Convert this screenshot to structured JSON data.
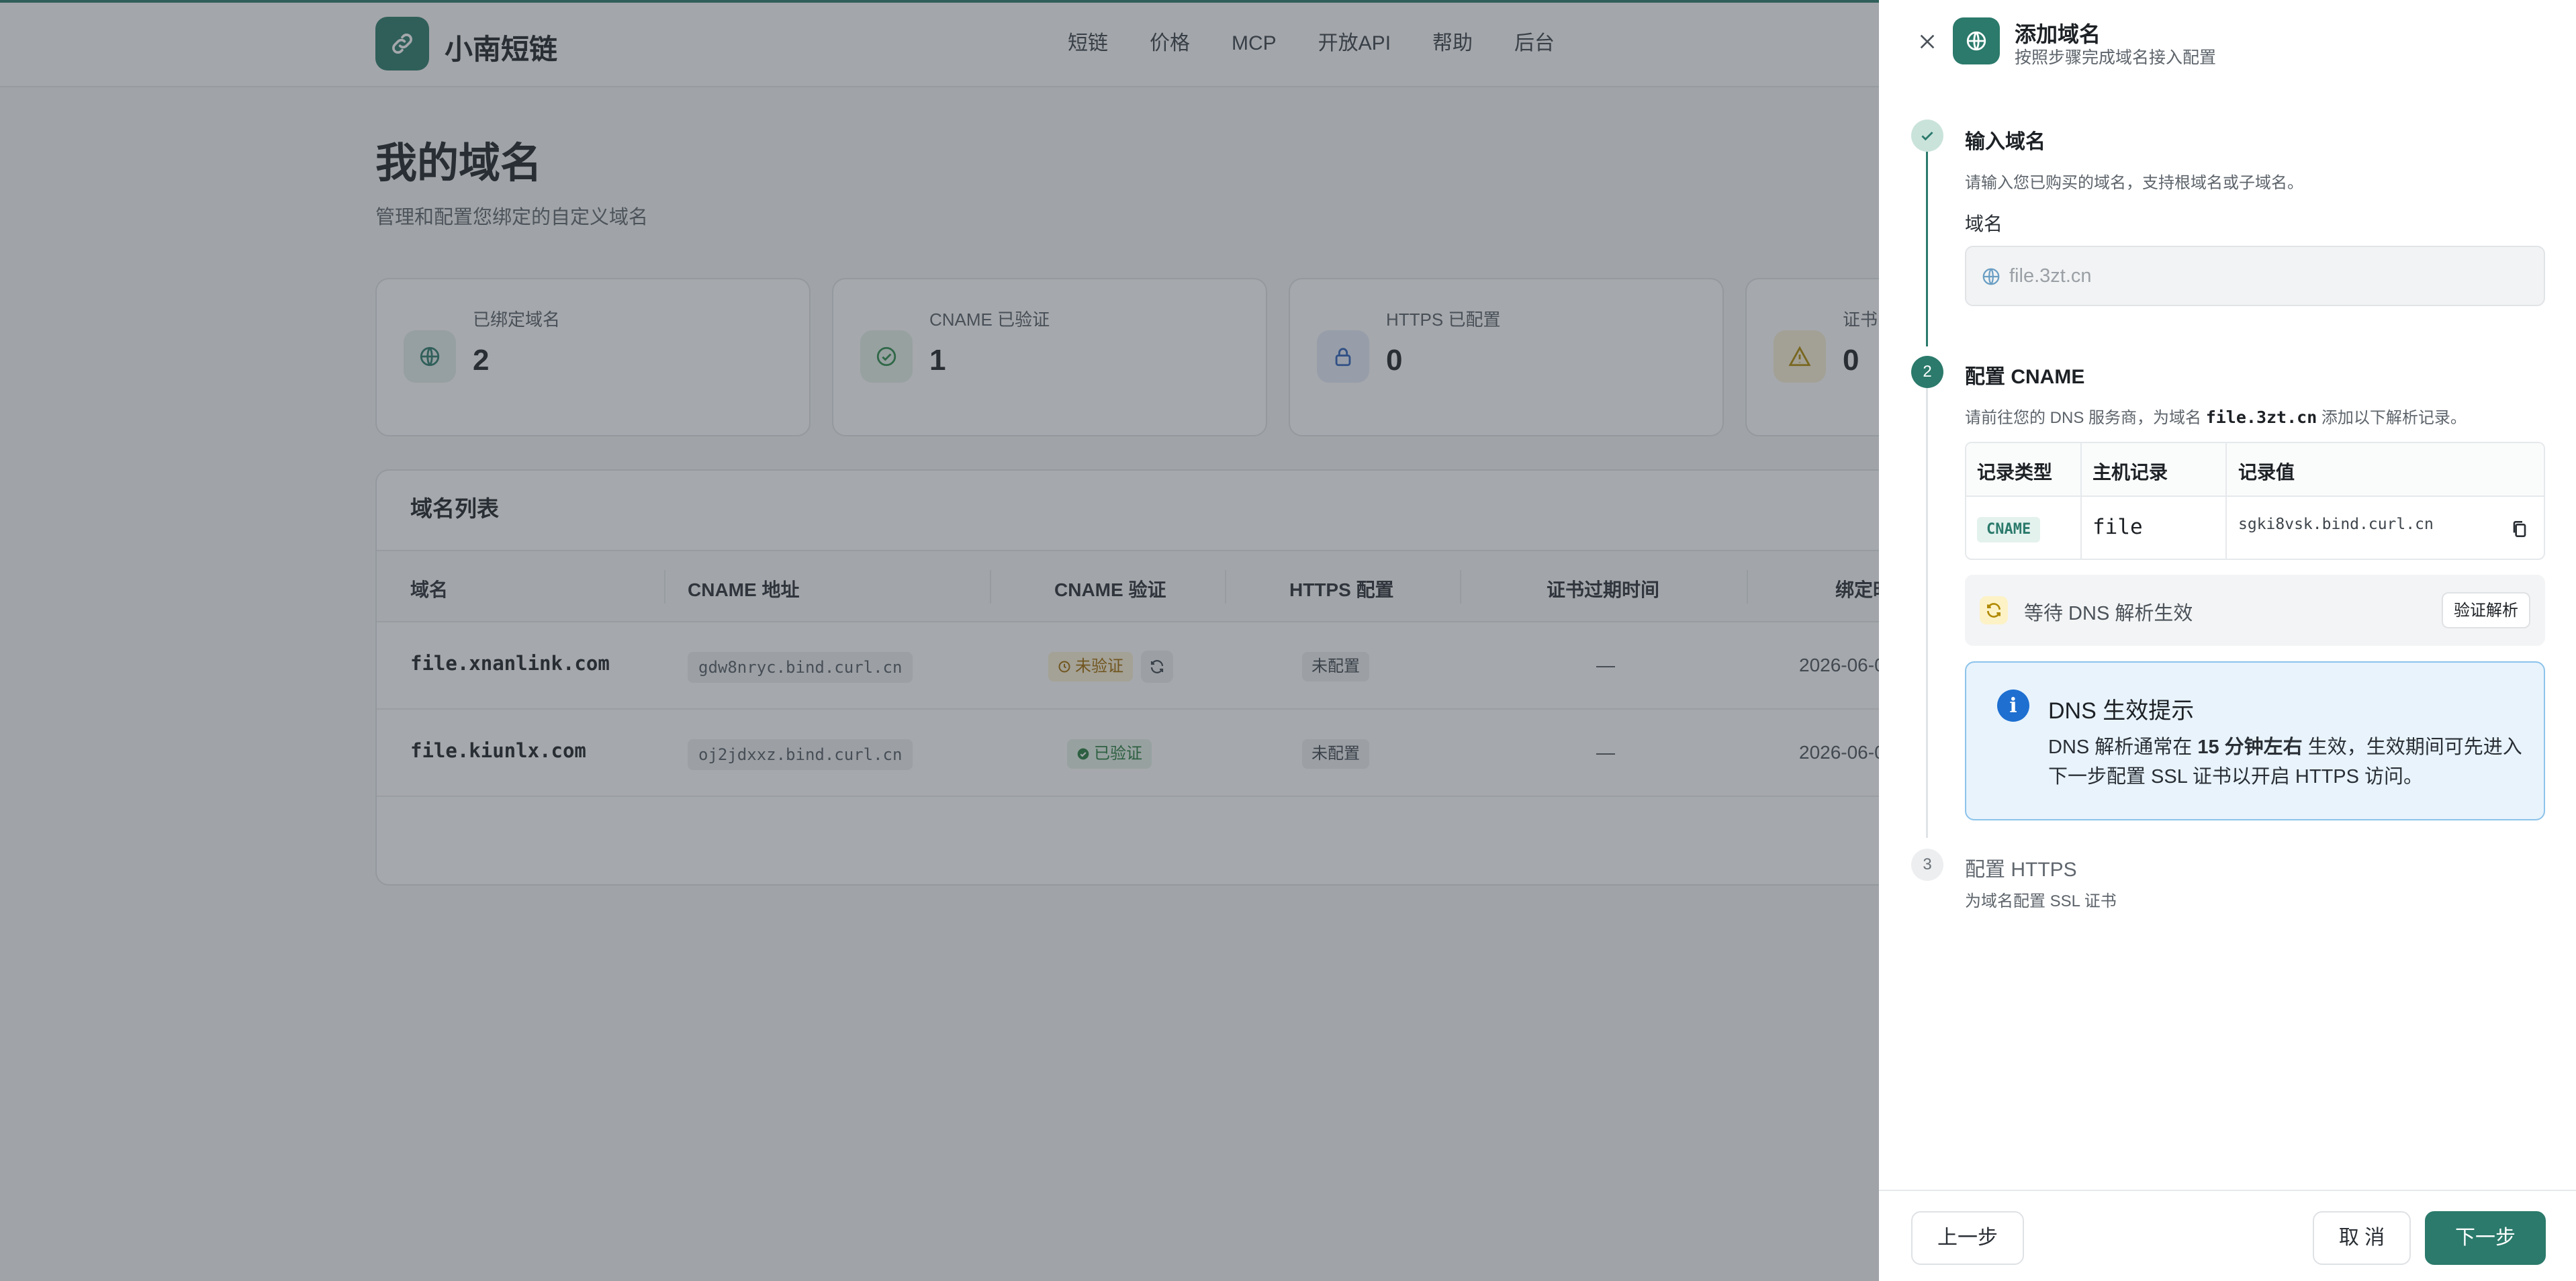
{
  "app": {
    "brand": "小南短链"
  },
  "nav": [
    "短链",
    "价格",
    "MCP",
    "开放API",
    "帮助",
    "后台"
  ],
  "page": {
    "title": "我的域名",
    "subtitle": "管理和配置您绑定的自定义域名"
  },
  "stats": [
    {
      "label": "已绑定域名",
      "value": "2",
      "icon": "globe-icon",
      "color": "#2b7a6b"
    },
    {
      "label": "CNAME 已验证",
      "value": "1",
      "icon": "check-circle-icon",
      "color": "#2b8a4a"
    },
    {
      "label": "HTTPS 已配置",
      "value": "0",
      "icon": "lock-icon",
      "color": "#2c5fb8"
    },
    {
      "label": "证书即将过期",
      "value": "0",
      "icon": "warning-icon",
      "color": "#b08900"
    }
  ],
  "list": {
    "title": "域名列表",
    "columns": [
      "域名",
      "CNAME 地址",
      "CNAME 验证",
      "HTTPS 配置",
      "证书过期时间",
      "绑定时间"
    ],
    "rows": [
      {
        "domain": "file.xnanlink.com",
        "cname": "gdw8nryc.bind.curl.cn",
        "verify": "未验证",
        "verify_state": "pending",
        "https": "未配置",
        "expire": "—",
        "bound": "2026-06-0"
      },
      {
        "domain": "file.kiunlx.com",
        "cname": "oj2jdxxz.bind.curl.cn",
        "verify": "已验证",
        "verify_state": "ok",
        "https": "未配置",
        "expire": "—",
        "bound": "2026-06-0"
      }
    ]
  },
  "drawer": {
    "title": "添加域名",
    "subtitle": "按照步骤完成域名接入配置",
    "steps": [
      {
        "num": "1",
        "title": "输入域名",
        "desc": "请输入您已购买的域名，支持根域名或子域名。",
        "state": "done"
      },
      {
        "num": "2",
        "title": "配置 CNAME",
        "desc_pre": "请前往您的 DNS 服务商，为域名 ",
        "desc_domain": "file.3zt.cn",
        "desc_post": " 添加以下解析记录。",
        "state": "active"
      },
      {
        "num": "3",
        "title": "配置 HTTPS",
        "desc": "为域名配置 SSL 证书",
        "state": "todo"
      }
    ],
    "field_label": "域名",
    "field_placeholder": "file.3zt.cn",
    "record_table": {
      "headers": [
        "记录类型",
        "主机记录",
        "记录值"
      ],
      "type": "CNAME",
      "host": "file",
      "value": "sgki8vsk.bind.curl.cn"
    },
    "wait_text": "等待 DNS 解析生效",
    "verify_button": "验证解析",
    "tip": {
      "title": "DNS 生效提示",
      "body_pre": "DNS 解析通常在 ",
      "body_bold": "15 分钟左右",
      "body_post": " 生效，生效期间可先进入下一步配置 SSL 证书以开启 HTTPS 访问。"
    },
    "buttons": {
      "prev": "上一步",
      "cancel": "取 消",
      "next": "下一步"
    }
  }
}
